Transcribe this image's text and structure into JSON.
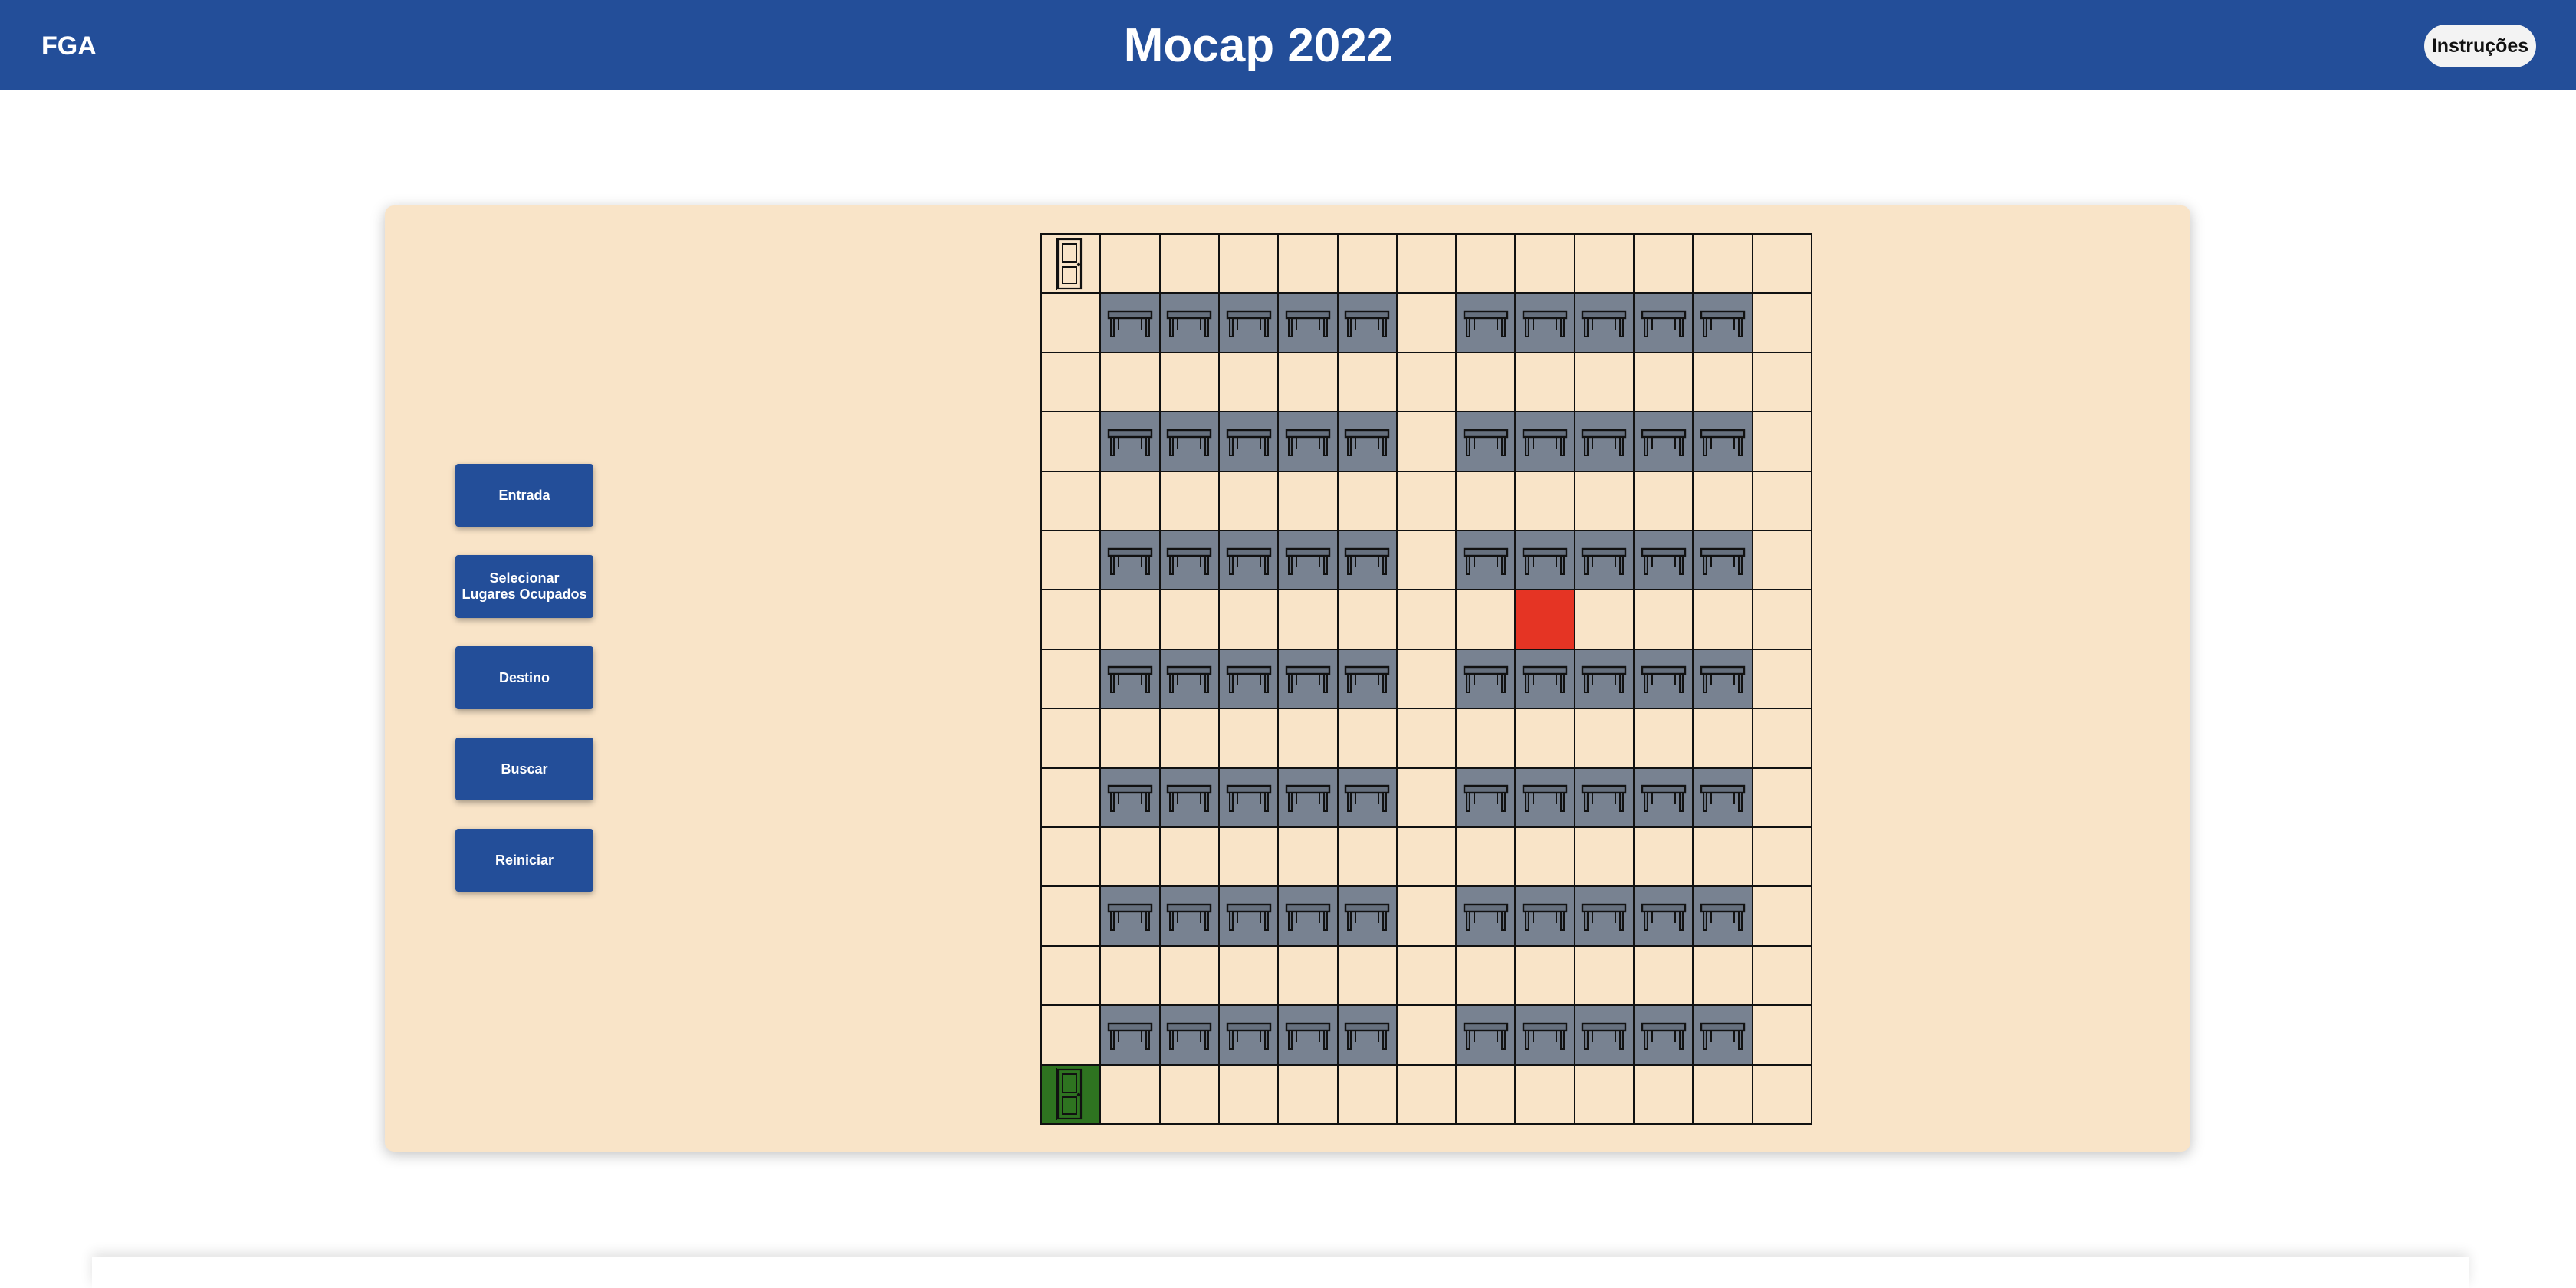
{
  "header": {
    "brand": "FGA",
    "title": "Mocap 2022",
    "instructions_label": "Instruções"
  },
  "controls": [
    {
      "name": "entrada-button",
      "label": "Entrada"
    },
    {
      "name": "selecionar-lugares-ocupados-button",
      "label": "Selecionar Lugares Ocupados"
    },
    {
      "name": "destino-button",
      "label": "Destino"
    },
    {
      "name": "buscar-button",
      "label": "Buscar"
    },
    {
      "name": "reiniciar-button",
      "label": "Reiniciar"
    }
  ],
  "grid": {
    "rows": 15,
    "cols": 13,
    "legend": "E = empty, T = table, D = door, G = entrance door (green), R = destination (red)",
    "cells": [
      "DEEEEEEEEEEEE",
      "ETTTTTETTTTTE",
      "EEEEEEEEEEEEE",
      "ETTTTTETTTTTE",
      "EEEEEEEEEEEEE",
      "ETTTTTETTTTTE",
      "EEEEEEEEREEEE",
      "ETTTTTETTTTTE",
      "EEEEEEEEEEEEE",
      "ETTTTTETTTTTE",
      "EEEEEEEEEEEEE",
      "ETTTTTETTTTTE",
      "EEEEEEEEEEEEE",
      "ETTTTTETTTTTE",
      "GEEEEEEEEEEEE"
    ]
  },
  "colors": {
    "header_bg": "#234e99",
    "panel_bg": "#f9e4c8",
    "table_cell": "#788291",
    "entrance_cell": "#2e7320",
    "destination_cell": "#e53424"
  }
}
